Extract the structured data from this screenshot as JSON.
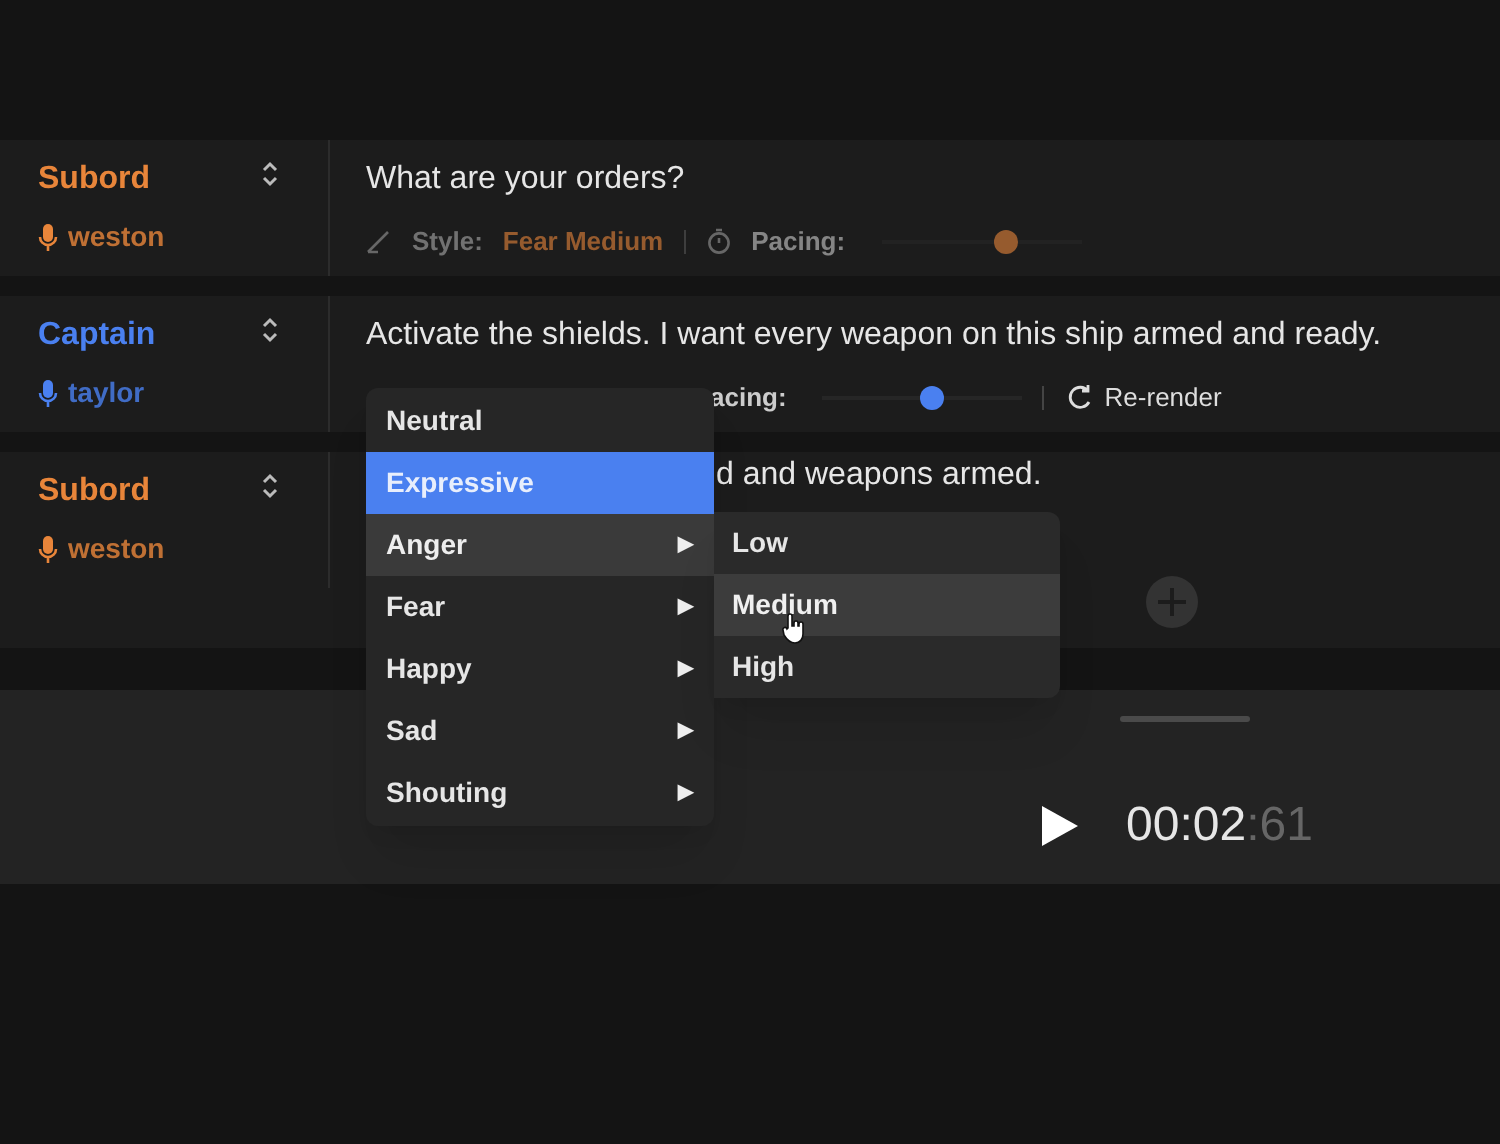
{
  "rows": [
    {
      "speaker": "Subord",
      "color": "#e8853a",
      "voice": "weston",
      "text": "What are your orders?",
      "controls": {
        "dimmed": true,
        "style_label": "Style:",
        "style_value": "Fear Medium",
        "pacing_label": "Pacing:",
        "level": 0.62
      }
    },
    {
      "speaker": "Captain",
      "color": "#4a80f0",
      "voice": "taylor",
      "text": "Activate the shields. I want every weapon on this ship armed and ready.",
      "controls": {
        "dimmed": false,
        "pacing_label": "acing:",
        "level": 0.55,
        "action": "Re-render"
      }
    },
    {
      "speaker": "Subord",
      "color": "#e8853a",
      "voice": "weston",
      "text": "d and weapons armed."
    }
  ],
  "menu": {
    "items": [
      {
        "label": "Neutral",
        "selected": false,
        "highlighted": false,
        "submenu": false
      },
      {
        "label": "Expressive",
        "selected": true,
        "highlighted": false,
        "submenu": false
      },
      {
        "label": "Anger",
        "selected": false,
        "highlighted": true,
        "submenu": true
      },
      {
        "label": "Fear",
        "selected": false,
        "highlighted": false,
        "submenu": true
      },
      {
        "label": "Happy",
        "selected": false,
        "highlighted": false,
        "submenu": true
      },
      {
        "label": "Sad",
        "selected": false,
        "highlighted": false,
        "submenu": true
      },
      {
        "label": "Shouting",
        "selected": false,
        "highlighted": false,
        "submenu": true
      }
    ],
    "arrow": "▶",
    "submenu": [
      {
        "label": "Low",
        "highlighted": false
      },
      {
        "label": "Medium",
        "highlighted": true
      },
      {
        "label": "High",
        "highlighted": false
      }
    ]
  },
  "player": {
    "time": "00:02",
    "fraction": ":61"
  }
}
